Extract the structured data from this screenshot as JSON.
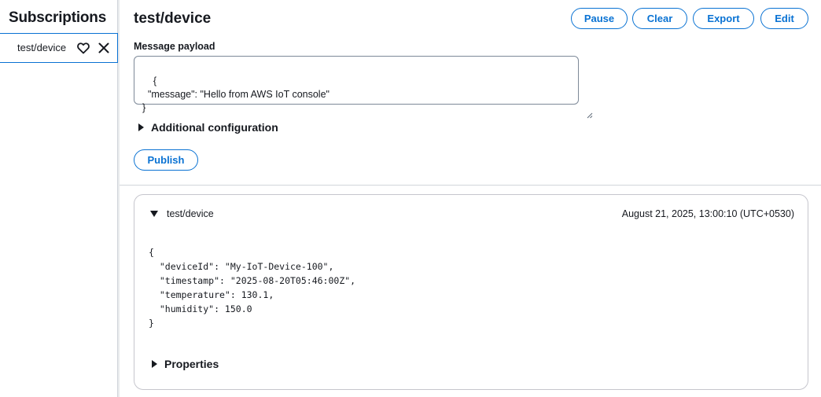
{
  "sidebar": {
    "title": "Subscriptions",
    "items": [
      {
        "label": "test/device",
        "icons": [
          "heart-icon",
          "close-icon"
        ]
      }
    ]
  },
  "main": {
    "topic_title": "test/device",
    "toolbar": {
      "pause_label": "Pause",
      "clear_label": "Clear",
      "export_label": "Export",
      "edit_label": "Edit"
    },
    "payload": {
      "label": "Message payload",
      "value": "{\n  \"message\": \"Hello from AWS IoT console\"\n}"
    },
    "additional_config_label": "Additional configuration",
    "publish_label": "Publish",
    "messages": [
      {
        "topic": "test/device",
        "timestamp": "August 21, 2025, 13:00:10 (UTC+0530)",
        "body": "{\n  \"deviceId\": \"My-IoT-Device-100\",\n  \"timestamp\": \"2025-08-20T05:46:00Z\",\n  \"temperature\": 130.1,\n  \"humidity\": 150.0\n}",
        "properties_label": "Properties"
      }
    ]
  },
  "colors": {
    "accent": "#0972d3",
    "text": "#16191f",
    "border": "#d1d5db"
  }
}
